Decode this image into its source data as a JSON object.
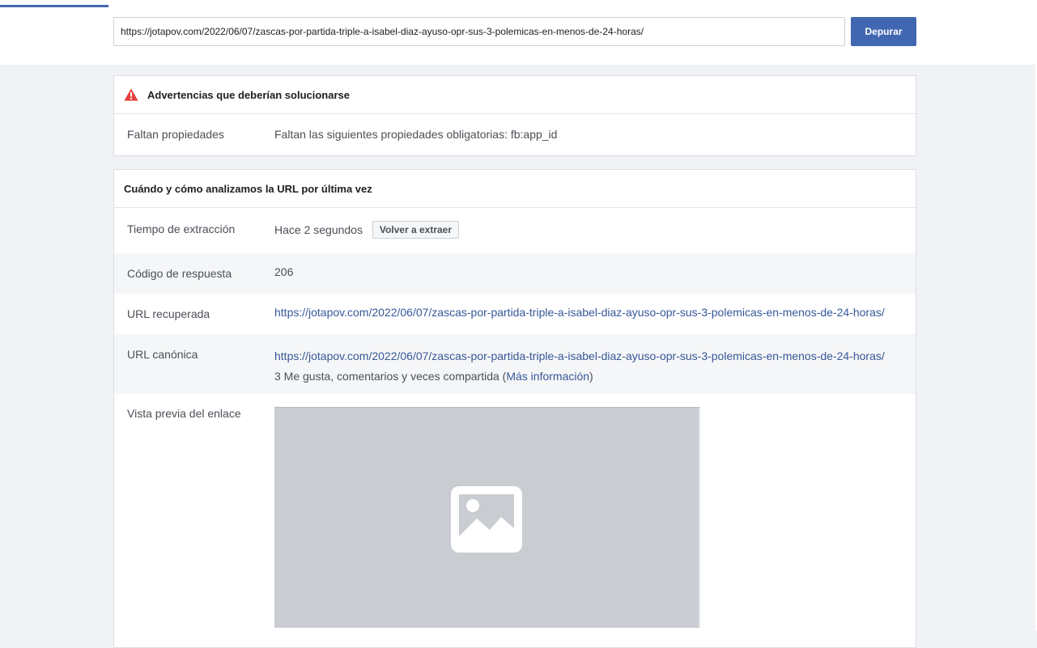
{
  "search": {
    "url_value": "https://jotapov.com/2022/06/07/zascas-por-partida-triple-a-isabel-diaz-ayuso-opr-sus-3-polemicas-en-menos-de-24-horas/",
    "debug_label": "Depurar"
  },
  "warnings": {
    "title": "Advertencias que deberían solucionarse",
    "rows": [
      {
        "label": "Faltan propiedades",
        "value": "Faltan las siguientes propiedades obligatorias: fb:app_id"
      }
    ]
  },
  "scrape": {
    "title": "Cuándo y cómo analizamos la URL por última vez",
    "fetch_time_label": "Tiempo de extracción",
    "fetch_time_value": "Hace 2 segundos",
    "refetch_label": "Volver a extraer",
    "response_code_label": "Código de respuesta",
    "response_code_value": "206",
    "fetched_url_label": "URL recuperada",
    "fetched_url_value": "https://jotapov.com/2022/06/07/zascas-por-partida-triple-a-isabel-diaz-ayuso-opr-sus-3-polemicas-en-menos-de-24-horas/",
    "canonical_url_label": "URL canónica",
    "canonical_url_value": "https://jotapov.com/2022/06/07/zascas-por-partida-triple-a-isabel-diaz-ayuso-opr-sus-3-polemicas-en-menos-de-24-horas/",
    "engagement_text": "3 Me gusta, comentarios y veces compartida (",
    "more_info_label": "Más información",
    "engagement_close": ")",
    "preview_label": "Vista previa del enlace"
  },
  "colors": {
    "accent": "#4267b2",
    "link": "#365899",
    "warning": "#e4403e",
    "placeholder": "#c9ccd1"
  },
  "icons": {
    "warning": "warning-triangle-icon",
    "image_placeholder": "image-placeholder-icon"
  }
}
